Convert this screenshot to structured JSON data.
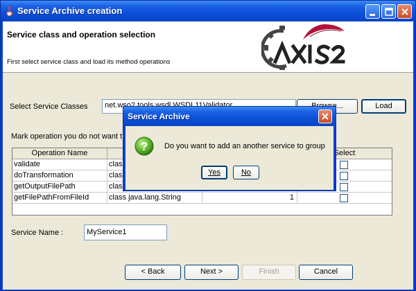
{
  "window": {
    "title": "Service Archive creation"
  },
  "header": {
    "title": "Service class and operation selection",
    "description": "First select service class and load its method operations"
  },
  "form": {
    "service_classes_label": "Select Service Classes",
    "service_classes_value": "net.wso2.tools.wsdl.WSDL11Validator",
    "browse_label": "Browse...",
    "load_label": "Load",
    "mark_label": "Mark operation you do not want t",
    "service_name_label": "Service Name :",
    "service_name_value": "MyService1"
  },
  "table": {
    "columns": [
      "Operation Name",
      "",
      "",
      "Select"
    ],
    "rows": [
      {
        "name": "validate",
        "return_type": "class",
        "params": "",
        "selected": false
      },
      {
        "name": "doTransformation",
        "return_type": "class",
        "params": "",
        "selected": false
      },
      {
        "name": "getOutputFilePath",
        "return_type": "class",
        "params": "",
        "selected": false
      },
      {
        "name": "getFilePathFromFileId",
        "return_type": "class java.lang.String",
        "params": "1",
        "selected": false
      }
    ]
  },
  "nav": {
    "back": "< Back",
    "next": "Next >",
    "finish": "Finish",
    "cancel": "Cancel"
  },
  "dialog": {
    "title": "Service Archive",
    "message": "Do you want to add an another service to group",
    "yes": "Yes",
    "no": "No"
  },
  "colors": {
    "title_bar": "#0b4fd9",
    "client_bg": "#ece9d8",
    "close_button": "#c94a22"
  },
  "icons": [
    "java-cup-icon",
    "minimize-icon",
    "maximize-icon",
    "close-icon",
    "axis2-logo",
    "question-icon"
  ]
}
